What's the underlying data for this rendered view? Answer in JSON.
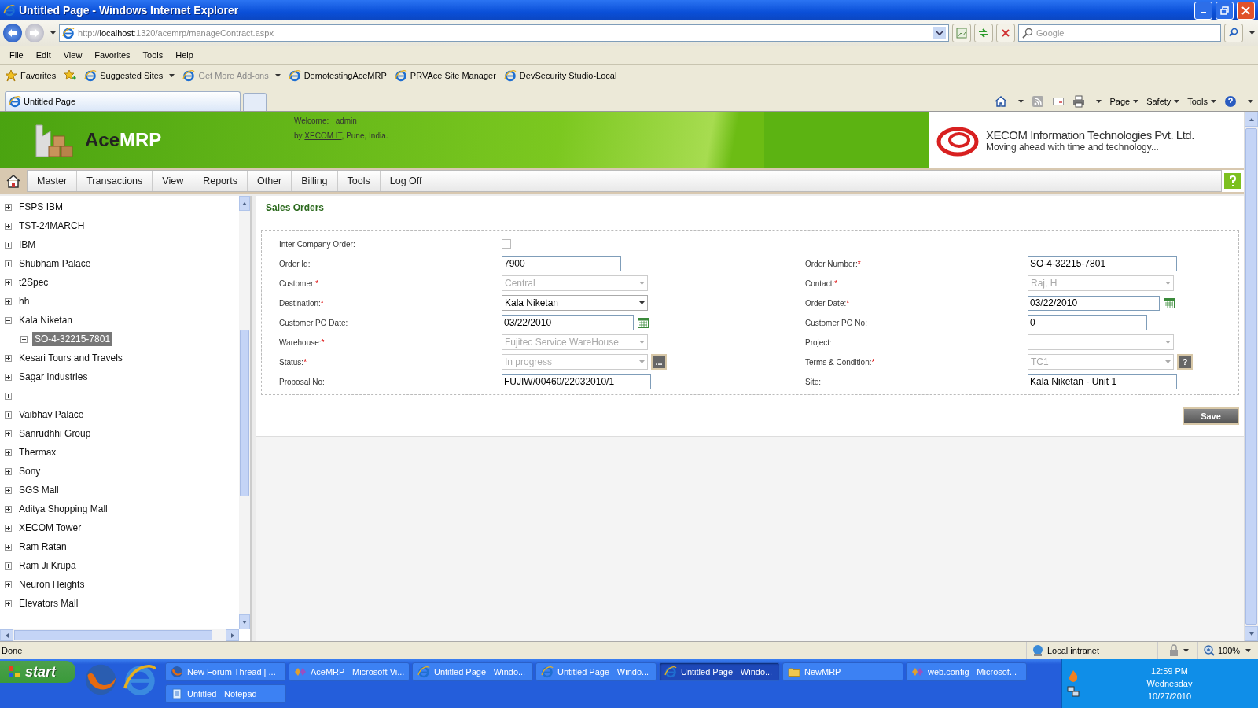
{
  "window": {
    "title": "Untitled Page - Windows Internet Explorer"
  },
  "address_bar": {
    "scheme": "http://",
    "host": "localhost",
    "path": ":1320/acemrp/manageContract.aspx"
  },
  "search": {
    "placeholder": "Google"
  },
  "menu": [
    "File",
    "Edit",
    "View",
    "Favorites",
    "Tools",
    "Help"
  ],
  "favorites_bar": {
    "label": "Favorites",
    "links": [
      {
        "label": "Suggested Sites",
        "dropdown": true,
        "disabled": false
      },
      {
        "label": "Get More Add-ons",
        "dropdown": true,
        "disabled": true
      },
      {
        "label": "DemotestingAceMRP",
        "dropdown": false,
        "disabled": false
      },
      {
        "label": "PRVAce Site Manager",
        "dropdown": false,
        "disabled": false
      },
      {
        "label": "DevSecurity Studio-Local",
        "dropdown": false,
        "disabled": false
      }
    ]
  },
  "browser_tabs": [
    {
      "label": "Untitled Page",
      "selected": true
    }
  ],
  "command_bar": [
    "Page",
    "Safety",
    "Tools"
  ],
  "header": {
    "logo": {
      "dark": "Ace",
      "light": "MRP"
    },
    "welcome_label": "Welcome:",
    "user": "admin",
    "by": "by",
    "company_link": "XECOM IT",
    "location": ", Pune, India.",
    "company_name": "XECOM Information Technologies Pvt. Ltd.",
    "tagline": "Moving ahead with time and technology..."
  },
  "nav": [
    "Master",
    "Transactions",
    "View",
    "Reports",
    "Other",
    "Billing",
    "Tools",
    "Log Off"
  ],
  "tree": [
    {
      "label": "FSPS IBM",
      "expanded": false,
      "selected": false
    },
    {
      "label": "TST-24MARCH",
      "expanded": false,
      "selected": false
    },
    {
      "label": "IBM",
      "expanded": false,
      "selected": false
    },
    {
      "label": "Shubham Palace",
      "expanded": false,
      "selected": false
    },
    {
      "label": "t2Spec",
      "expanded": false,
      "selected": false
    },
    {
      "label": "hh",
      "expanded": false,
      "selected": false
    },
    {
      "label": "Kala Niketan",
      "expanded": true,
      "selected": false,
      "children": [
        {
          "label": "SO-4-32215-7801",
          "expanded": false,
          "selected": true
        }
      ]
    },
    {
      "label": "Kesari Tours and Travels",
      "expanded": false,
      "selected": false
    },
    {
      "label": "Sagar Industries",
      "expanded": false,
      "selected": false
    },
    {
      "expanded": false
    },
    {
      "label": "Vaibhav Palace",
      "expanded": false,
      "selected": false
    },
    {
      "label": "Sanrudhhi Group",
      "expanded": false,
      "selected": false
    },
    {
      "label": "Thermax",
      "expanded": false,
      "selected": false
    },
    {
      "label": "Sony",
      "expanded": false,
      "selected": false
    },
    {
      "label": "SGS Mall",
      "expanded": false,
      "selected": false
    },
    {
      "label": "Aditya Shopping Mall",
      "expanded": false,
      "selected": false
    },
    {
      "label": "XECOM Tower",
      "expanded": false,
      "selected": false
    },
    {
      "label": "Ram Ratan",
      "expanded": false,
      "selected": false
    },
    {
      "label": "Ram Ji Krupa",
      "expanded": false,
      "selected": false
    },
    {
      "label": "Neuron Heights",
      "expanded": false,
      "selected": false
    },
    {
      "label": "Elevators Mall",
      "expanded": false,
      "selected": false
    }
  ],
  "form": {
    "title": "Sales Orders",
    "rows": [
      {
        "left": {
          "label": "Inter Company Order:",
          "kind": "checkbox",
          "checked": false
        }
      },
      {
        "left": {
          "label": "Order Id:",
          "kind": "text",
          "value": "7900"
        },
        "right": {
          "label": "Order Number:",
          "required_mark": "*",
          "kind": "text",
          "value": "SO-4-32215-7801"
        }
      },
      {
        "left": {
          "label": "Customer:",
          "required_mark": "*",
          "kind": "select",
          "value": "Central",
          "disabled": true
        },
        "right": {
          "label": "Contact:",
          "required_mark": "*",
          "kind": "select",
          "value": "Raj, H",
          "disabled": true
        }
      },
      {
        "left": {
          "label": "Destination:",
          "required_mark": "*",
          "kind": "select",
          "value": "Kala Niketan",
          "disabled": false
        },
        "right": {
          "label": "Order Date:",
          "required_mark": "*",
          "kind": "date",
          "value": "03/22/2010"
        }
      },
      {
        "left": {
          "label": "Customer PO Date:",
          "kind": "date",
          "value": "03/22/2010"
        },
        "right": {
          "label": "Customer PO No:",
          "kind": "text",
          "value": "0"
        }
      },
      {
        "left": {
          "label": "Warehouse:",
          "required_mark": "*",
          "kind": "select",
          "value": "Fujitec Service WareHouse",
          "disabled": true
        },
        "right": {
          "label": "Project:",
          "kind": "select",
          "disabled": true
        }
      },
      {
        "left": {
          "label": "Status:",
          "required_mark": "*",
          "kind": "select",
          "value": "In progress",
          "disabled": true,
          "button": "..."
        },
        "right": {
          "label": "Terms & Condition:",
          "required_mark": "*",
          "kind": "select",
          "value": "TC1",
          "disabled": true,
          "button": "?"
        }
      },
      {
        "left": {
          "label": "Proposal No:",
          "kind": "text",
          "value": "FUJIW/00460/22032010/1"
        },
        "right": {
          "label": "Site:",
          "kind": "text",
          "value": "Kala Niketan - Unit 1"
        }
      }
    ],
    "save": "Save"
  },
  "status_bar": {
    "text": "Done",
    "zone": "Local intranet",
    "zoom": "100%"
  },
  "taskbar": {
    "start": "start",
    "buttons": [
      {
        "label": "New Forum Thread | ...",
        "kind": "firefox",
        "selected": false
      },
      {
        "label": "AceMRP - Microsoft Vi...",
        "kind": "studio",
        "selected": false
      },
      {
        "label": "Untitled Page - Windo...",
        "kind": "ie",
        "selected": false
      },
      {
        "label": "Untitled Page - Windo...",
        "kind": "ie",
        "selected": false
      },
      {
        "label": "Untitled Page - Windo...",
        "kind": "ie",
        "selected": true
      },
      {
        "label": "NewMRP",
        "kind": "folder",
        "selected": false
      },
      {
        "label": "web.config - Microsof...",
        "kind": "studio",
        "selected": false
      },
      {
        "label": "Untitled - Notepad",
        "kind": "notepad",
        "selected": false
      }
    ],
    "time": "12:59 PM",
    "day": "Wednesday",
    "date": "10/27/2010"
  }
}
